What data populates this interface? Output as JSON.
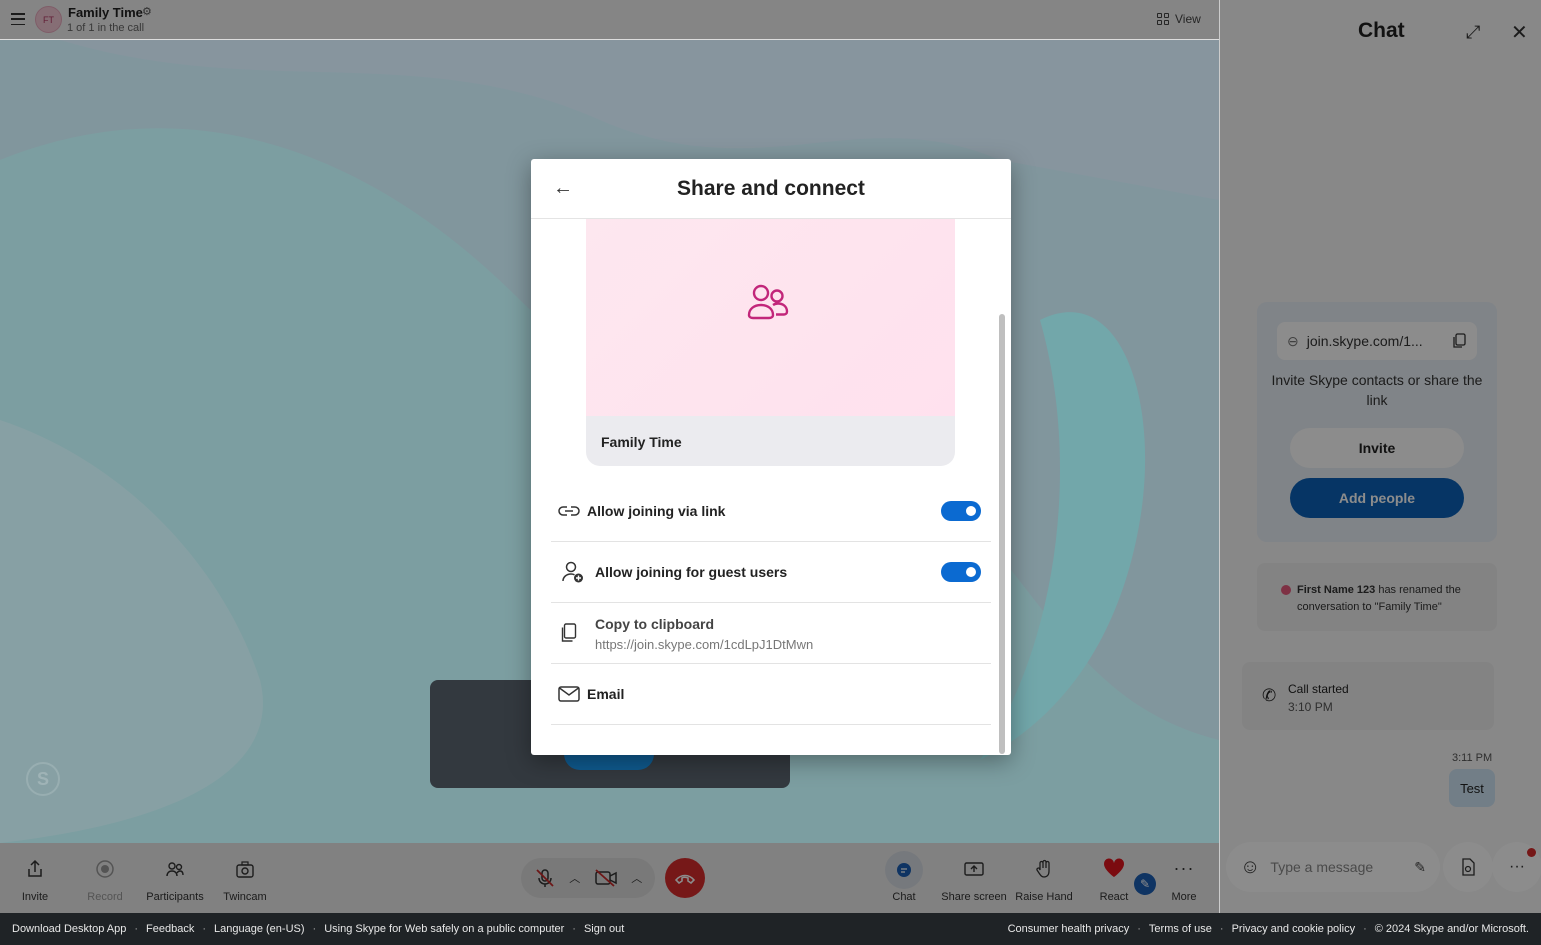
{
  "call_header": {
    "avatar_initials": "FT",
    "title": "Family Time",
    "subtitle": "1 of 1 in the call",
    "view_label": "View"
  },
  "toolbar": {
    "invite": "Invite",
    "record": "Record",
    "participants": "Participants",
    "twincam": "Twincam",
    "chat": "Chat",
    "share_screen": "Share screen",
    "raise_hand": "Raise Hand",
    "react": "React",
    "more": "More"
  },
  "modal": {
    "title": "Share and connect",
    "preview_name": "Family Time",
    "allow_link_label": "Allow joining via link",
    "allow_link_on": true,
    "allow_guest_label": "Allow joining for guest users",
    "allow_guest_on": true,
    "copy_label": "Copy to clipboard",
    "copy_url": "https://join.skype.com/1cdLpJ1DtMwn",
    "email_label": "Email"
  },
  "chat": {
    "title": "Chat",
    "link_text": "join.skype.com/1...",
    "invite_text": "Invite Skype contacts or share the link",
    "invite_button": "Invite",
    "add_people_button": "Add people",
    "rename_user": "First Name 123",
    "rename_text": " has renamed the conversation to \"Family Time\"",
    "call_started": "Call started",
    "call_time": "3:10 PM",
    "message_time": "3:11 PM",
    "message_text": "Test",
    "composer_placeholder": "Type a message"
  },
  "footer": {
    "left_links": [
      "Download Desktop App",
      "Feedback",
      "Language (en-US)",
      "Using Skype for Web safely on a public computer",
      "Sign out"
    ],
    "right_links": [
      "Consumer health privacy",
      "Terms of use",
      "Privacy and cookie policy"
    ],
    "copyright": "© 2024 Skype and/or Microsoft."
  },
  "colors": {
    "accent": "#0b6ad1",
    "hangup": "#d82d2d",
    "preview_pink": "#fde7ef",
    "people_icon": "#c2267a"
  },
  "icons": [
    "hamburger-icon",
    "gear-icon",
    "grid-icon",
    "back-arrow-icon",
    "people-icon",
    "link-icon",
    "add-guest-icon",
    "clipboard-icon",
    "email-icon",
    "expand-icon",
    "close-icon",
    "emoji-icon",
    "phone-icon"
  ]
}
